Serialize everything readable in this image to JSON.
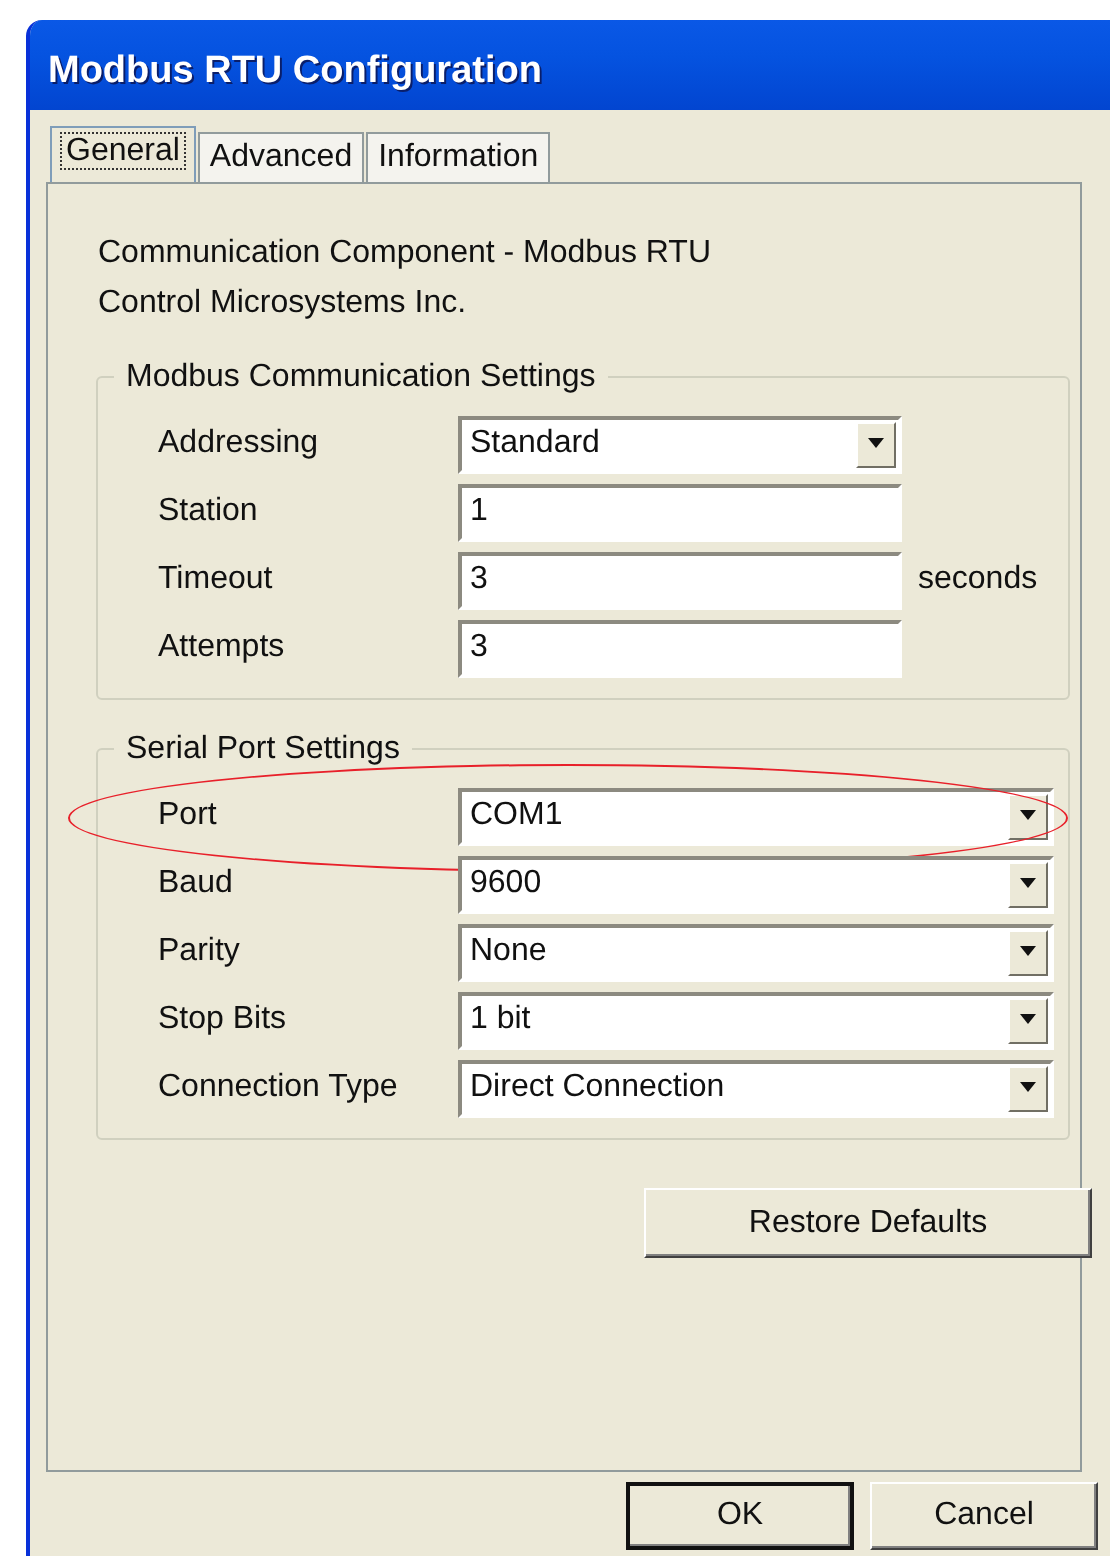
{
  "window": {
    "title": "Modbus RTU Configuration"
  },
  "tabs": [
    {
      "label": "General",
      "selected": true
    },
    {
      "label": "Advanced",
      "selected": false
    },
    {
      "label": "Information",
      "selected": false
    }
  ],
  "description": [
    "Communication Component - Modbus RTU",
    "Control Microsystems Inc."
  ],
  "groups": [
    {
      "title": "Modbus Communication Settings",
      "wide": false,
      "fields": [
        {
          "label": "Addressing",
          "kind": "dropdown",
          "value": "Standard",
          "highlighted": false
        },
        {
          "label": "Station",
          "kind": "text",
          "value": "1",
          "highlighted": false
        },
        {
          "label": "Timeout",
          "kind": "text",
          "value": "3",
          "suffix": "seconds",
          "highlighted": false
        },
        {
          "label": "Attempts",
          "kind": "text",
          "value": "3",
          "highlighted": false
        }
      ]
    },
    {
      "title": "Serial Port Settings",
      "wide": true,
      "fields": [
        {
          "label": "Port",
          "kind": "dropdown",
          "value": "COM1",
          "highlighted": true
        },
        {
          "label": "Baud",
          "kind": "dropdown",
          "value": "9600",
          "highlighted": false
        },
        {
          "label": "Parity",
          "kind": "dropdown",
          "value": "None",
          "highlighted": false
        },
        {
          "label": "Stop Bits",
          "kind": "dropdown",
          "value": "1 bit",
          "highlighted": false
        },
        {
          "label": "Connection Type",
          "kind": "dropdown",
          "value": "Direct Connection",
          "highlighted": false
        }
      ]
    }
  ],
  "restore_button": "Restore Defaults",
  "buttons": [
    {
      "label": "OK",
      "default": true
    },
    {
      "label": "Cancel",
      "default": false
    }
  ]
}
